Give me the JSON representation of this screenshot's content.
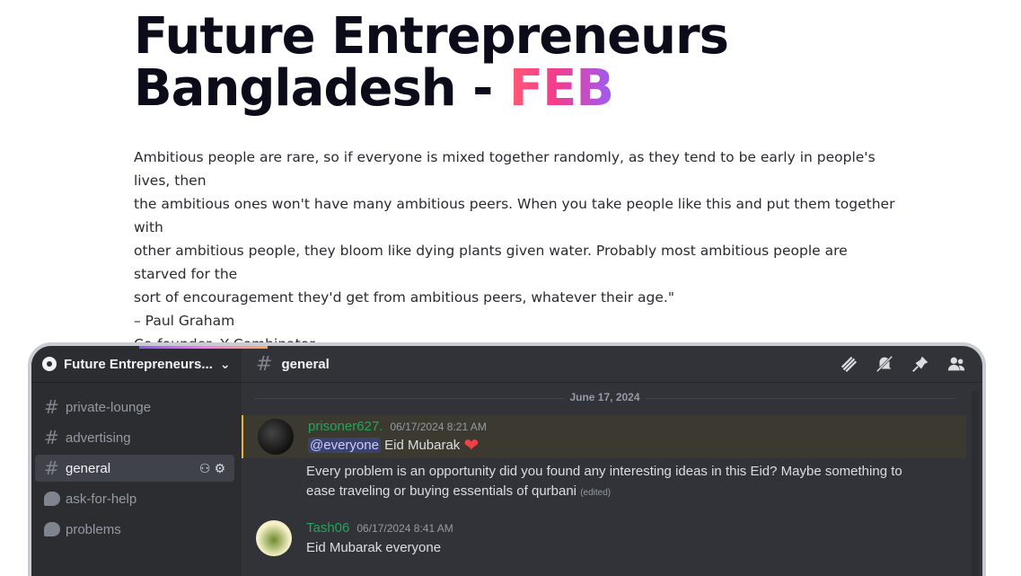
{
  "hero": {
    "title_line1": "Future Entrepreneurs",
    "title_line2_prefix": "Bangladesh - ",
    "title_accent": "FEB"
  },
  "quote": {
    "lines": [
      "Ambitious people are rare, so if everyone is mixed together randomly, as they tend to be early in people's lives, then",
      "the ambitious ones won't have many ambitious peers. When you take people like this and put them together with",
      "other ambitious people, they bloom like dying plants given water. Probably most ambitious people are starved for the",
      "sort of encouragement they'd get from ambitious peers, whatever their age.\""
    ],
    "author": "– Paul Graham",
    "role": "Co-founder, Y Combinator"
  },
  "discord": {
    "server_name": "Future Entrepreneurs...",
    "channels": [
      {
        "name": "private-lounge",
        "type": "text-locked"
      },
      {
        "name": "advertising",
        "type": "text-locked"
      },
      {
        "name": "general",
        "type": "text",
        "active": true
      },
      {
        "name": "ask-for-help",
        "type": "forum"
      },
      {
        "name": "problems",
        "type": "forum"
      }
    ],
    "active_channel": "general",
    "date_divider": "June 17, 2024",
    "messages": [
      {
        "username": "prisoner627.",
        "timestamp": "06/17/2024 8:21 AM",
        "mention": "@everyone",
        "line1": " Eid Mubarak ",
        "line2": "Every problem is an opportunity did you found any interesting ideas in this Eid? Maybe something to",
        "line3": "ease traveling or buying essentials of qurbani",
        "edited": "(edited)"
      },
      {
        "username": "Tash06",
        "timestamp": "06/17/2024 8:41 AM",
        "line1": "Eid Mubarak everyone"
      }
    ],
    "colors": {
      "bg": "#313338",
      "sidebar": "#2b2d31",
      "username": "#23a55a",
      "mention_bg": "#3c3a30"
    }
  }
}
